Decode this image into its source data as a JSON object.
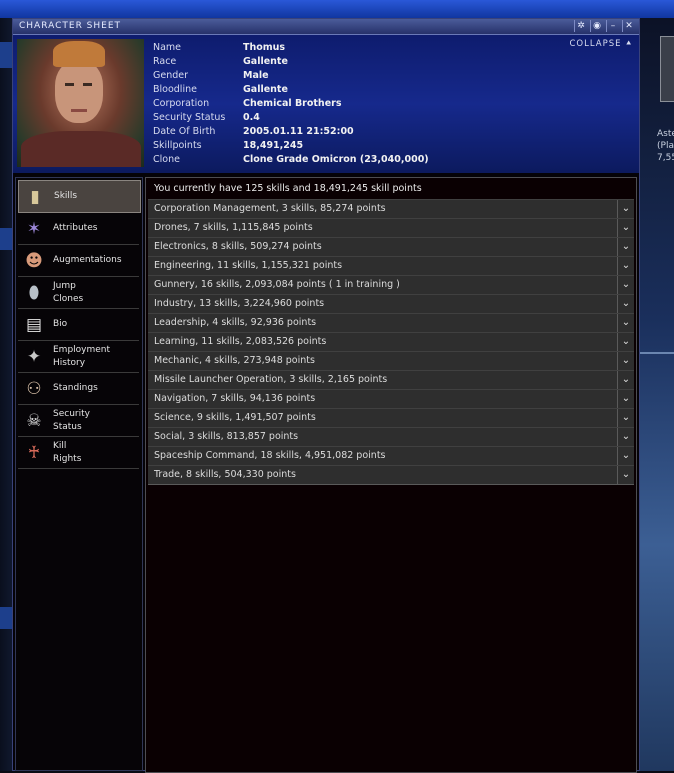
{
  "window": {
    "title": "CHARACTER SHEET",
    "collapse_label": "COLLAPSE"
  },
  "character": {
    "fields": [
      {
        "label": "Name",
        "value": "Thomus"
      },
      {
        "label": "Race",
        "value": "Gallente"
      },
      {
        "label": "Gender",
        "value": "Male"
      },
      {
        "label": "Bloodline",
        "value": "Gallente"
      },
      {
        "label": "Corporation",
        "value": "Chemical Brothers"
      },
      {
        "label": "Security Status",
        "value": "0.4"
      },
      {
        "label": "Date Of Birth",
        "value": "2005.01.11  21:52:00"
      },
      {
        "label": "Skillpoints",
        "value": "18,491,245"
      },
      {
        "label": "Clone",
        "value": "Clone Grade Omicron (23,040,000)"
      }
    ]
  },
  "sidebar": {
    "items": [
      {
        "label": "Skills",
        "icon": "skill-book-icon"
      },
      {
        "label": "Attributes",
        "icon": "attributes-icon"
      },
      {
        "label": "Augmentations",
        "icon": "augmentations-icon"
      },
      {
        "label": "Jump\nClones",
        "icon": "jump-clones-icon"
      },
      {
        "label": "Bio",
        "icon": "bio-icon"
      },
      {
        "label": "Employment\nHistory",
        "icon": "employment-history-icon"
      },
      {
        "label": "Standings",
        "icon": "standings-icon"
      },
      {
        "label": "Security\nStatus",
        "icon": "security-status-icon"
      },
      {
        "label": "Kill\nRights",
        "icon": "kill-rights-icon"
      }
    ]
  },
  "skills": {
    "summary": "You currently have 125 skills and 18,491,245 skill points",
    "groups": [
      "Corporation Management, 3 skills, 85,274 points",
      "Drones, 7 skills, 1,115,845 points",
      "Electronics, 8 skills, 509,274 points",
      "Engineering, 11  skills, 1,155,321  points",
      "Gunnery, 16 skills, 2,093,084 points ( 1 in training )",
      "Industry, 13 skills, 3,224,960 points",
      "Leadership, 4 skills, 92,936 points",
      "Learning, 11  skills, 2,083,526 points",
      "Mechanic, 4 skills, 273,948 points",
      "Missile Launcher Operation, 3 skills, 2,165 points",
      "Navigation, 7 skills, 94,136 points",
      "Science, 9 skills, 1,491,507 points",
      "Social, 3 skills, 813,857 points",
      "Spaceship Command, 18 skills, 4,951,082 points",
      "Trade, 8 skills, 504,330 points"
    ]
  },
  "background": {
    "right_text_1": "Aste",
    "right_text_2": "(Pla",
    "right_text_3": "7,55"
  }
}
